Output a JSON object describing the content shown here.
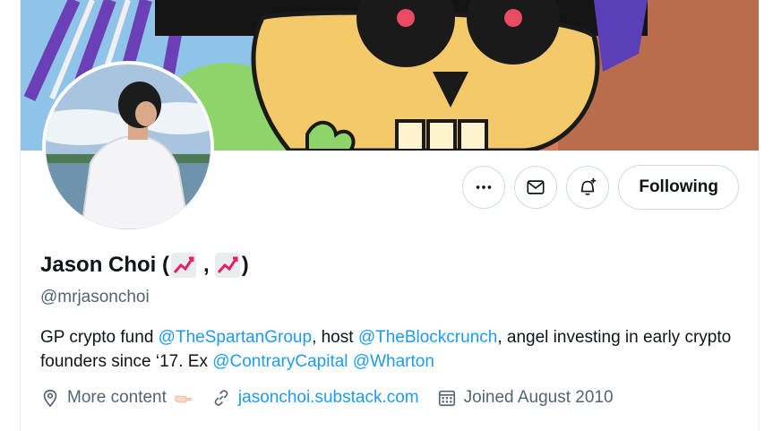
{
  "profile": {
    "name": "Jason Choi (",
    "name_sep": ",",
    "name_end": ")",
    "handle": "@mrjasonchoi",
    "name_emoji": "chart-increasing-icon"
  },
  "actions": {
    "more_icon": "more-icon",
    "message_icon": "mail-icon",
    "notify_icon": "bell-plus-icon",
    "follow_label": "Following"
  },
  "bio": {
    "t1": "GP crypto fund ",
    "m1": "@TheSpartanGroup",
    "t2": ", host ",
    "m2": "@TheBlockcrunch",
    "t3": ", angel investing in early crypto founders since ‘17. Ex ",
    "m3": "@ContraryCapital",
    "t4": " ",
    "m4": "@Wharton"
  },
  "meta": {
    "location": "More content",
    "location_emoji": "pointing-hand-icon",
    "website": "jasonchoi.substack.com",
    "joined": "Joined August 2010"
  },
  "colors": {
    "link": "#1d9bf0",
    "muted": "#536471",
    "text": "#0f1419"
  }
}
